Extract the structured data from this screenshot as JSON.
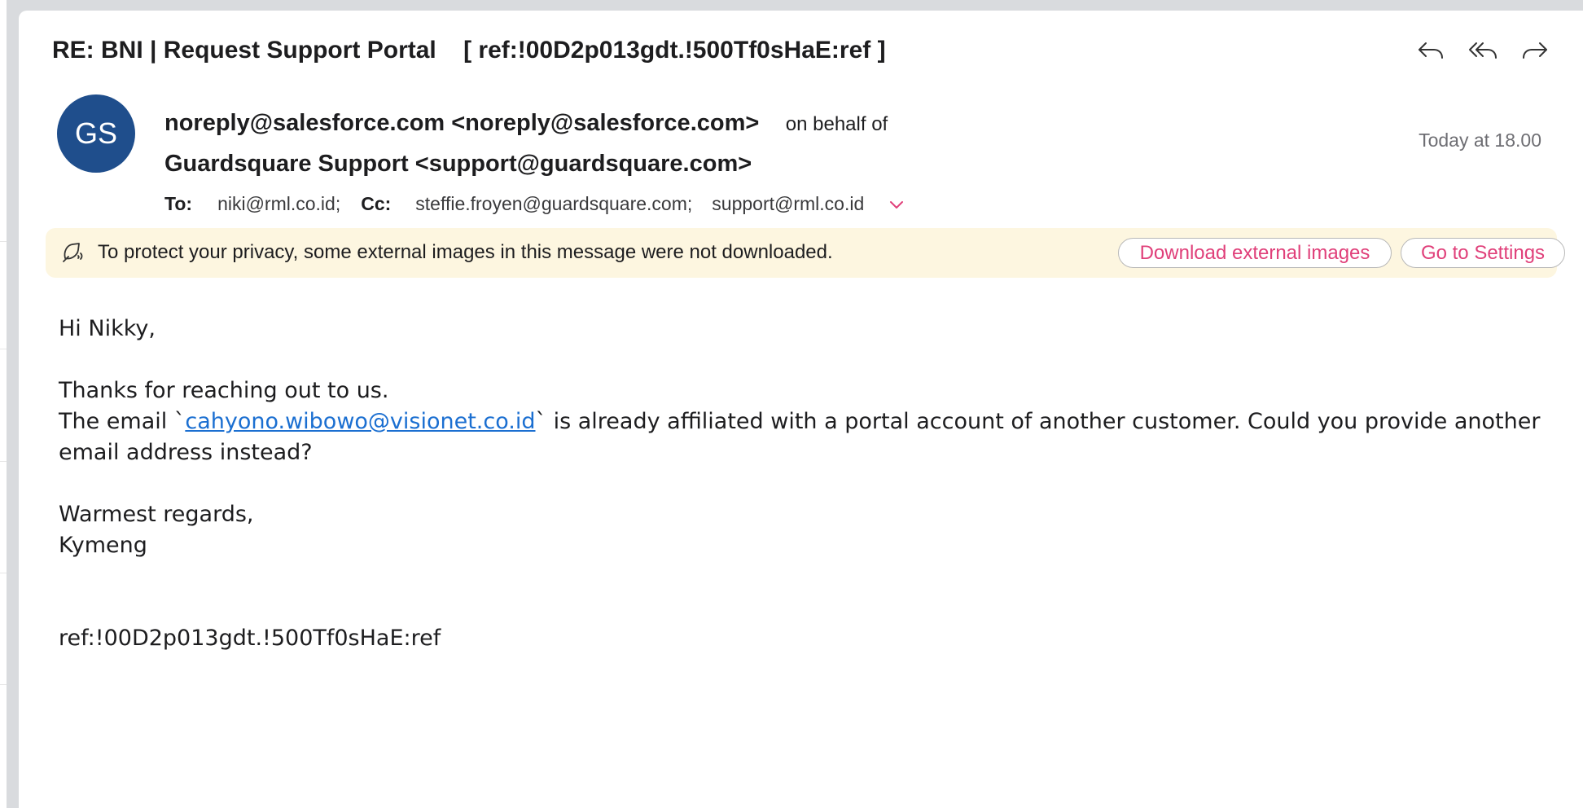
{
  "message": {
    "subject": "RE: BNI | Request Support Portal    [ ref:!00D2p013gdt.!500Tf0sHaE:ref ]",
    "avatar_initials": "GS",
    "avatar_color": "#1f4e8c",
    "sender": "noreply@salesforce.com <noreply@salesforce.com>",
    "on_behalf_label": "on behalf of",
    "on_behalf_sender": "Guardsquare Support <support@guardsquare.com>",
    "date": "Today at 18.00",
    "to_label": "To:",
    "to": "niki@rml.co.id;",
    "cc_label": "Cc:",
    "cc": [
      "steffie.froyen@guardsquare.com;",
      "support@rml.co.id"
    ]
  },
  "actions": {
    "reply_icon": "reply-icon",
    "reply_all_icon": "reply-all-icon",
    "forward_icon": "forward-icon"
  },
  "privacy_banner": {
    "icon": "privacy-shield-icon",
    "text": "To protect your privacy, some external images in this message were not downloaded.",
    "download_label": "Download external images",
    "settings_label": "Go to Settings",
    "accent_color": "#e0407a",
    "background": "#fdf6e0"
  },
  "body": {
    "greeting": "Hi Nikky,",
    "line1": "Thanks for reaching out to us.",
    "line2_before": "The email `",
    "line2_link": "cahyono.wibowo@visionet.co.id",
    "line2_after": "` is already affiliated with a portal account of another customer. Could you provide another",
    "line3": "email address instead?",
    "closing": "Warmest regards,",
    "signature": "Kymeng",
    "ref": "ref:!00D2p013gdt.!500Tf0sHaE:ref"
  }
}
